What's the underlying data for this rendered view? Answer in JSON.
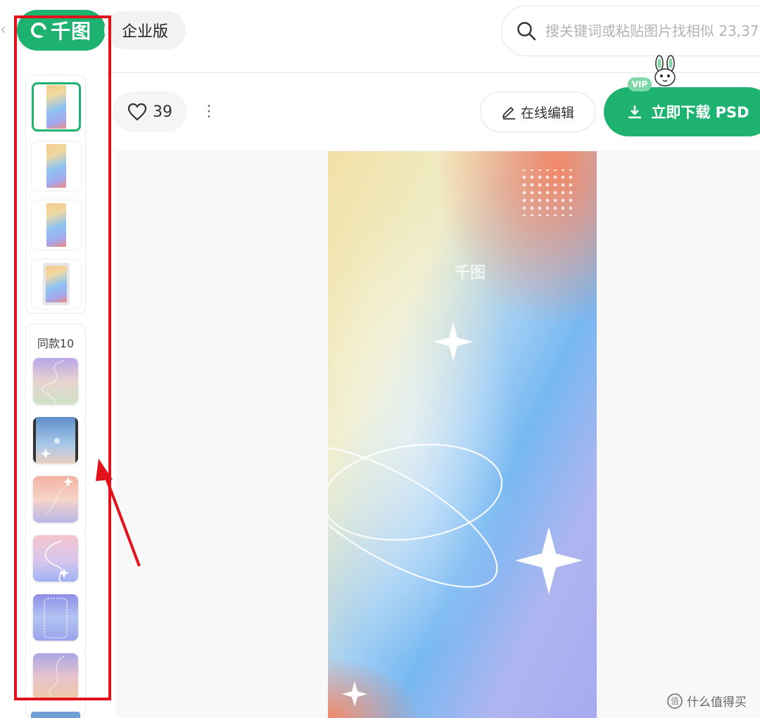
{
  "header": {
    "back_glyph": "‹",
    "logo_text": "千图",
    "enterprise_label": "企业版",
    "search_placeholder": "搜关键词或粘贴图片找相似 23,37"
  },
  "sidebar": {
    "versions": [
      {
        "kind": "poster",
        "active": true
      },
      {
        "kind": "poster",
        "active": false
      },
      {
        "kind": "poster",
        "active": false
      },
      {
        "kind": "framed",
        "active": false
      }
    ],
    "same_style_label": "同款10",
    "same_style_items": [
      {
        "name": "pastel-wave"
      },
      {
        "name": "blue-phone"
      },
      {
        "name": "sunset-stars"
      },
      {
        "name": "pink-swirl"
      },
      {
        "name": "purple-phone"
      },
      {
        "name": "mauve-curve"
      }
    ]
  },
  "toolbar": {
    "like_count": "39",
    "more_glyph": "⋮",
    "edit_label": "在线编辑",
    "download_label": "立即下载 PSD",
    "vip_badge": "VIP"
  },
  "canvas": {
    "watermark_logo": "千图"
  },
  "footer": {
    "site_badge": "值",
    "site_watermark": "什么值得买"
  },
  "colors": {
    "brand": "#1eb270",
    "annotation": "#e2121c"
  }
}
